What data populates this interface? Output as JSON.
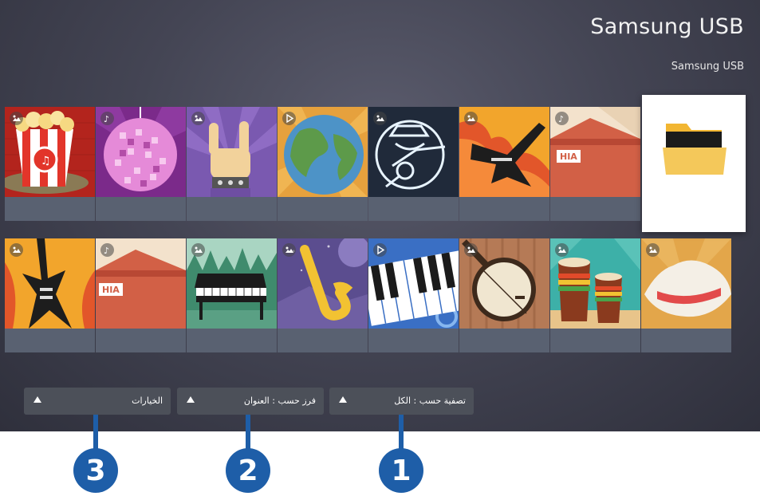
{
  "header": {
    "title": "Samsung USB",
    "path": "Samsung USB"
  },
  "content": {
    "row1": [
      {
        "media": "photo",
        "name": "popcorn"
      },
      {
        "media": "music",
        "name": "disco-ball"
      },
      {
        "media": "photo",
        "name": "rock-hand"
      },
      {
        "media": "video",
        "name": "globe"
      },
      {
        "media": "photo",
        "name": "guitarist"
      },
      {
        "media": "photo",
        "name": "electric-guitar"
      },
      {
        "media": "music",
        "name": "barn"
      }
    ],
    "row2": [
      {
        "media": "photo",
        "name": "electric-guitar"
      },
      {
        "media": "music",
        "name": "barn"
      },
      {
        "media": "photo",
        "name": "piano"
      },
      {
        "media": "photo",
        "name": "saxophone"
      },
      {
        "media": "video",
        "name": "keyboard"
      },
      {
        "media": "photo",
        "name": "banjo"
      },
      {
        "media": "photo",
        "name": "drums"
      },
      {
        "media": "photo",
        "name": "cowboy-hat"
      }
    ],
    "selected": "folder"
  },
  "bottom_bar": {
    "filter_label": "تصفية حسب : الكل",
    "sort_label": "فرز حسب : العنوان",
    "options_label": "الخيارات"
  },
  "callouts": {
    "one": "1",
    "two": "2",
    "three": "3"
  },
  "colors": {
    "callout": "#1e5ea8",
    "caption": "#596171",
    "background": "#444554",
    "button": "#4c5059"
  }
}
